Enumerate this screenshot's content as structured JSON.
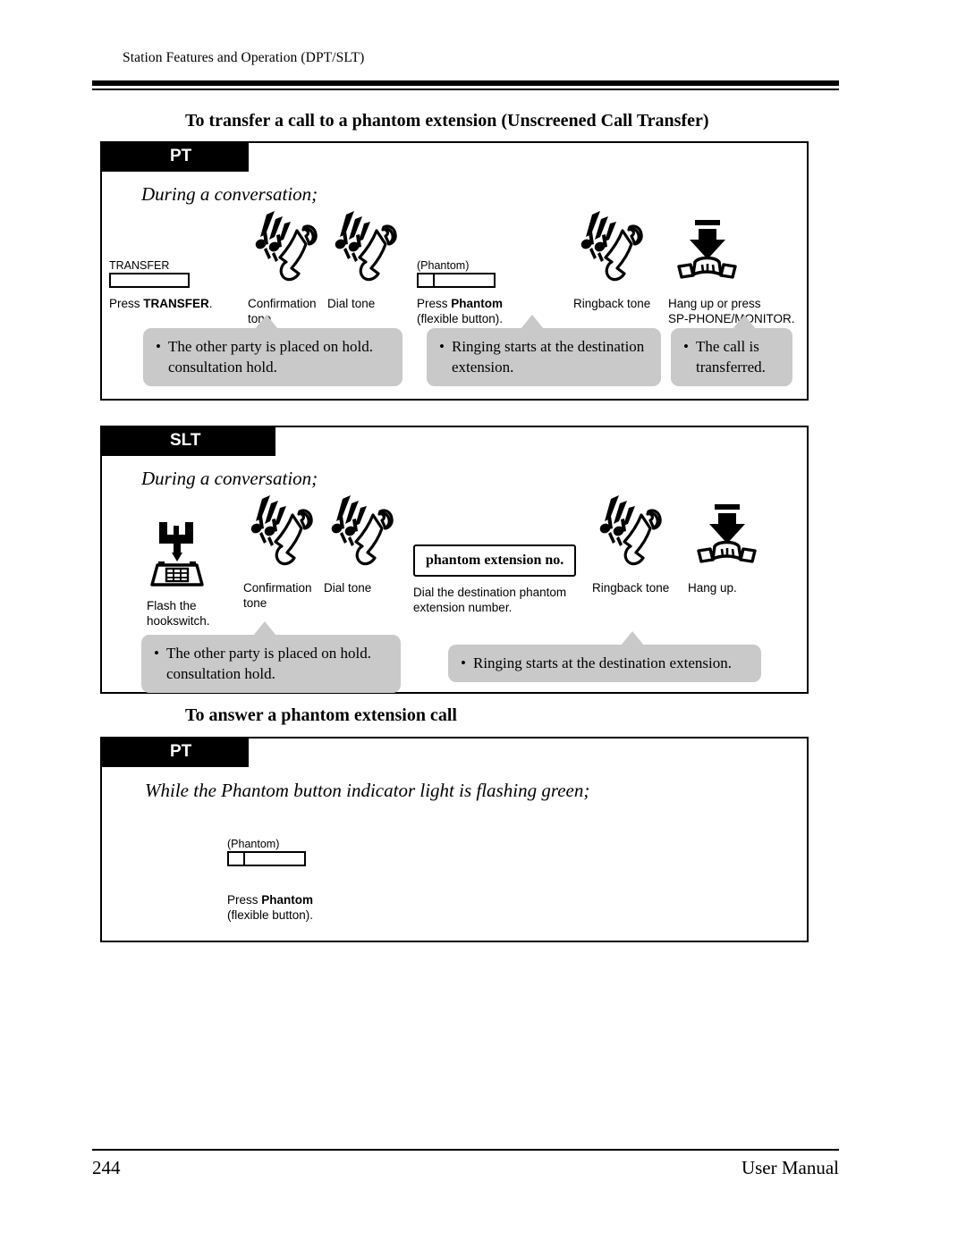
{
  "header": {
    "breadcrumb": "Station Features and Operation (DPT/SLT)"
  },
  "footer": {
    "page_number": "244",
    "manual_label": "User Manual"
  },
  "sections": [
    {
      "heading": "To transfer a call to a phantom extension (Unscreened Call Transfer)",
      "tab": "PT",
      "context": "During a conversation;",
      "steps": [
        {
          "icon": "transfer-button-icon",
          "cap": "TRANSFER",
          "label_plain": "Press ",
          "label_bold": "TRANSFER",
          "label_tail": "."
        },
        {
          "icon": "ringing-handset-icon",
          "label": "Confirmation\ntone"
        },
        {
          "icon": "ringing-handset-icon",
          "label": "Dial tone"
        },
        {
          "icon": "phantom-button-icon",
          "cap": "(Phantom)",
          "label_plain": "Press ",
          "label_bold": "Phantom",
          "label_tail": "\n(flexible button)."
        },
        {
          "icon": "ringing-handset-icon",
          "label": "Ringback tone"
        },
        {
          "icon": "hang-up-icon",
          "label": "Hang up or press\nSP-PHONE/MONITOR."
        }
      ],
      "callouts": [
        "The other party is placed on hold.\nconsultation hold.",
        "Ringing starts at the destination\nextension.",
        "The call is\ntransferred."
      ]
    },
    {
      "heading": "",
      "tab": "SLT",
      "context": "During a conversation;",
      "steps": [
        {
          "icon": "hookswitch-flash-icon",
          "label": "Flash the\nhookswitch."
        },
        {
          "icon": "ringing-handset-icon",
          "label": "Confirmation\ntone"
        },
        {
          "icon": "ringing-handset-icon",
          "label": "Dial tone"
        },
        {
          "icon": "dial-number-box",
          "box_text": "phantom extension no.",
          "label": "Dial the destination phantom\nextension number."
        },
        {
          "icon": "ringing-handset-icon",
          "label": "Ringback tone"
        },
        {
          "icon": "hang-up-icon",
          "label": "Hang up."
        }
      ],
      "callouts": [
        "The other party is placed on hold.\nconsultation hold.",
        "Ringing starts at the destination extension."
      ]
    },
    {
      "heading": "To answer a phantom extension call",
      "tab": "PT",
      "context": "While the Phantom button indicator light is flashing green;",
      "steps": [
        {
          "icon": "phantom-button-icon",
          "cap": "(Phantom)",
          "label_plain": "Press ",
          "label_bold": "Phantom",
          "label_tail": "\n(flexible button)."
        }
      ],
      "callouts": []
    }
  ],
  "colors": {
    "callout_gray": "#c9c9c9",
    "tab_black": "#000000",
    "page_background": "#ffffff"
  }
}
